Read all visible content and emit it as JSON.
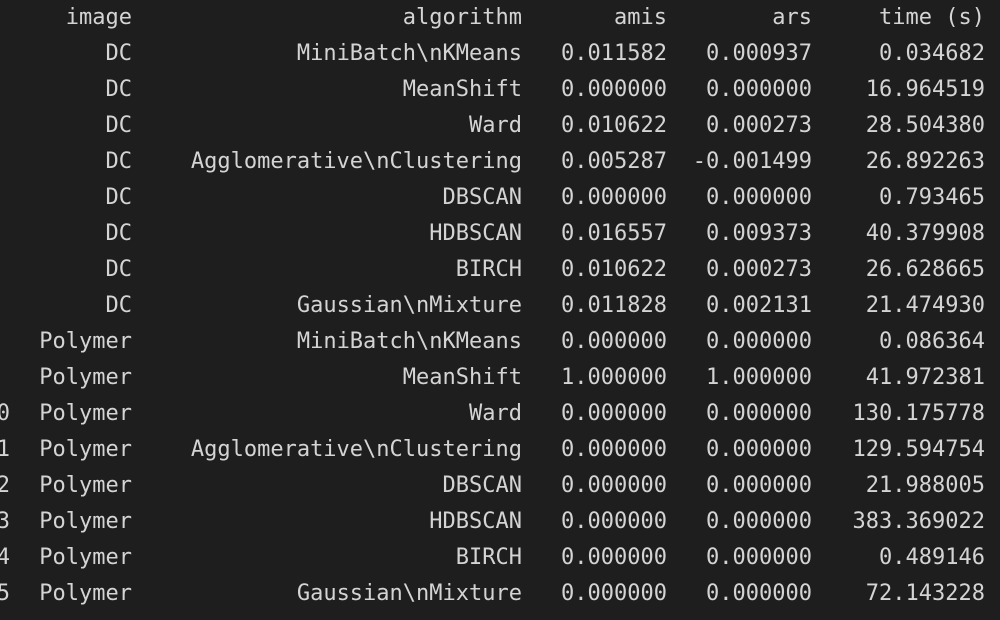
{
  "table": {
    "columns": [
      "image",
      "algorithm",
      "amis",
      "ars",
      "time (s)"
    ],
    "rows": [
      {
        "index": "",
        "image": "DC",
        "algorithm": "MiniBatch\\nKMeans",
        "amis": "0.011582",
        "ars": "0.000937",
        "time": "0.034682"
      },
      {
        "index": "",
        "image": "DC",
        "algorithm": "MeanShift",
        "amis": "0.000000",
        "ars": "0.000000",
        "time": "16.964519"
      },
      {
        "index": "",
        "image": "DC",
        "algorithm": "Ward",
        "amis": "0.010622",
        "ars": "0.000273",
        "time": "28.504380"
      },
      {
        "index": "",
        "image": "DC",
        "algorithm": "Agglomerative\\nClustering",
        "amis": "0.005287",
        "ars": "-0.001499",
        "time": "26.892263"
      },
      {
        "index": "",
        "image": "DC",
        "algorithm": "DBSCAN",
        "amis": "0.000000",
        "ars": "0.000000",
        "time": "0.793465"
      },
      {
        "index": "",
        "image": "DC",
        "algorithm": "HDBSCAN",
        "amis": "0.016557",
        "ars": "0.009373",
        "time": "40.379908"
      },
      {
        "index": "",
        "image": "DC",
        "algorithm": "BIRCH",
        "amis": "0.010622",
        "ars": "0.000273",
        "time": "26.628665"
      },
      {
        "index": "",
        "image": "DC",
        "algorithm": "Gaussian\\nMixture",
        "amis": "0.011828",
        "ars": "0.002131",
        "time": "21.474930"
      },
      {
        "index": "",
        "image": "Polymer",
        "algorithm": "MiniBatch\\nKMeans",
        "amis": "0.000000",
        "ars": "0.000000",
        "time": "0.086364"
      },
      {
        "index": "",
        "image": "Polymer",
        "algorithm": "MeanShift",
        "amis": "1.000000",
        "ars": "1.000000",
        "time": "41.972381"
      },
      {
        "index": "0",
        "image": "Polymer",
        "algorithm": "Ward",
        "amis": "0.000000",
        "ars": "0.000000",
        "time": "130.175778"
      },
      {
        "index": "1",
        "image": "Polymer",
        "algorithm": "Agglomerative\\nClustering",
        "amis": "0.000000",
        "ars": "0.000000",
        "time": "129.594754"
      },
      {
        "index": "2",
        "image": "Polymer",
        "algorithm": "DBSCAN",
        "amis": "0.000000",
        "ars": "0.000000",
        "time": "21.988005"
      },
      {
        "index": "3",
        "image": "Polymer",
        "algorithm": "HDBSCAN",
        "amis": "0.000000",
        "ars": "0.000000",
        "time": "383.369022"
      },
      {
        "index": "4",
        "image": "Polymer",
        "algorithm": "BIRCH",
        "amis": "0.000000",
        "ars": "0.000000",
        "time": "0.489146"
      },
      {
        "index": "5",
        "image": "Polymer",
        "algorithm": "Gaussian\\nMixture",
        "amis": "0.000000",
        "ars": "0.000000",
        "time": "72.143228"
      }
    ]
  }
}
